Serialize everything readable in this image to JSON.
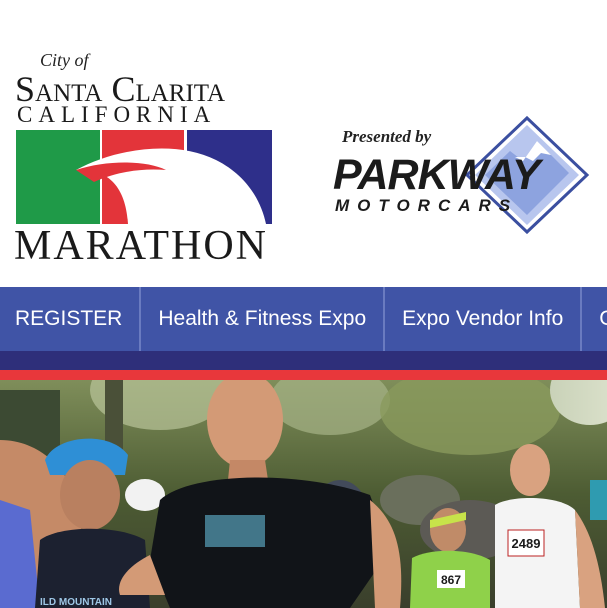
{
  "logo": {
    "city_of": "City of",
    "city_name": "Santa Clarita",
    "state": "CALIFORNIA",
    "event": "MARATHON",
    "colors": {
      "green": "#1f9a48",
      "red": "#e3343a",
      "navy": "#2e2f8a"
    }
  },
  "sponsor": {
    "presented_by": "Presented by",
    "name": "PARKWAY",
    "subname": "MOTORCARS",
    "icon": "mountain-diamond-icon"
  },
  "nav": {
    "items": [
      {
        "label": "REGISTER"
      },
      {
        "label": "Health & Fitness Expo"
      },
      {
        "label": "Expo Vendor Info"
      },
      {
        "label": "Gen"
      }
    ]
  },
  "hero": {
    "bibs": [
      "2489",
      "867"
    ],
    "shirt_text": "ILD MOUNTAIN"
  },
  "colors": {
    "nav_bg": "#4054a6",
    "nav_divider": "#6a7bc0",
    "band_dark": "#2e2f7a",
    "band_red": "#e8373b"
  }
}
